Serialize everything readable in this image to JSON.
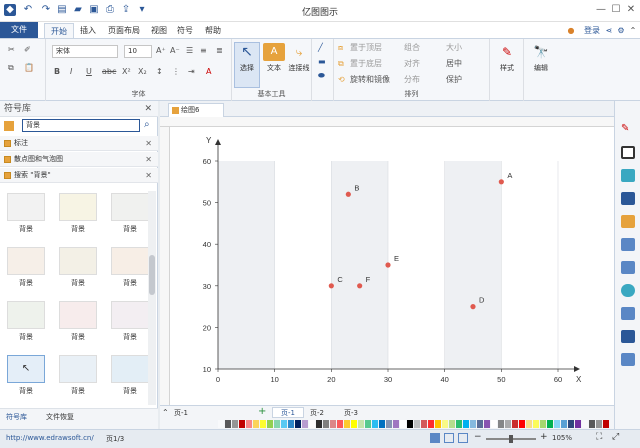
{
  "app": {
    "title": "亿图图示"
  },
  "ribbon_tabs": [
    "文件",
    "开始",
    "插入",
    "页面布局",
    "视图",
    "符号",
    "帮助"
  ],
  "top_right": {
    "login": "登录"
  },
  "font": {
    "name": "宋体",
    "size": "10"
  },
  "groups": {
    "font": "字体",
    "basic_tools": "基本工具",
    "arrange": "排列"
  },
  "tools": {
    "select": "选择",
    "text": "文本",
    "connector": "连接线",
    "style": "样式",
    "edit": "编辑"
  },
  "arrange_items": [
    "置于顶层",
    "组合",
    "大小",
    "置于底层",
    "对齐",
    "居中",
    "旋转和镜像",
    "分布",
    "保护"
  ],
  "left_panel": {
    "title": "符号库",
    "search_value": "背景",
    "categories": [
      "标注",
      "散点图和气泡图",
      "搜索 \"背景\""
    ],
    "thumb_label": "背景",
    "tabs": [
      "符号库",
      "文件恢复"
    ]
  },
  "doc_tab": "绘图6",
  "page_tabs": [
    "页-1",
    "页-1",
    "页-2",
    "页-3"
  ],
  "status": {
    "url": "http://www.edrawsoft.cn/",
    "page": "页1/3",
    "zoom": "105%"
  },
  "colors": {
    "accent": "#2b5797",
    "point": "#e05a4f",
    "grid_band": "#eef0f3"
  },
  "chart_data": {
    "type": "scatter",
    "xlabel": "X",
    "ylabel": "Y",
    "xlim": [
      0,
      60
    ],
    "ylim": [
      10,
      60
    ],
    "xticks": [
      0,
      10,
      20,
      30,
      40,
      50,
      60
    ],
    "yticks": [
      10,
      20,
      30,
      40,
      50,
      60
    ],
    "points": [
      {
        "label": "A",
        "x": 50,
        "y": 55
      },
      {
        "label": "B",
        "x": 23,
        "y": 52
      },
      {
        "label": "C",
        "x": 20,
        "y": 30
      },
      {
        "label": "F",
        "x": 25,
        "y": 30
      },
      {
        "label": "E",
        "x": 30,
        "y": 35
      },
      {
        "label": "D",
        "x": 45,
        "y": 25
      }
    ]
  }
}
